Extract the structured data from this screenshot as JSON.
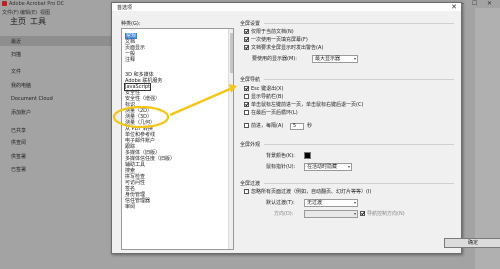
{
  "app": {
    "title": "Adobe Acrobat Pro DC",
    "menu": [
      "文件(F)",
      "编辑(E)",
      "视图"
    ],
    "tabs": [
      "主页",
      "工具"
    ],
    "left_items": [
      "最近",
      "扫描",
      "文件",
      "我的电脑",
      "Document Cloud",
      "添加账户",
      "已共享",
      "供查阅",
      "供签署",
      "已签署"
    ],
    "sections": [
      "位置",
      "共享"
    ]
  },
  "dialog": {
    "title": "首选项",
    "close": "✕",
    "category_label": "种类(G):",
    "categories": [
      "常规",
      "文档",
      "页面显示",
      "一般",
      "注释",
      "3D 和多媒体",
      "Adobe 联机服务",
      "JavaScript",
      "安全性",
      "安全性（增强）",
      "标识",
      "测量（2D）",
      "测量（3D）",
      "测量（几何）",
      "从 PDF 转换",
      "单位和参考线",
      "电子邮件账户",
      "跟踪",
      "多媒体（旧版）",
      "多媒体信任度（旧版）",
      "辅助工具",
      "搜索",
      "拼写检查",
      "可访问性",
      "签名",
      "身份管理",
      "信任管理器",
      "审阅"
    ],
    "selected_category": "常规",
    "highlighted_category": "JavaScript",
    "groups": {
      "general": {
        "title": "全屏设置",
        "opt1": "仅限于当前文档(N)",
        "opt2": "一次使用一页填充屏幕(F)",
        "opt3": "文档要求全屏显示时发出警告(A)",
        "monitor_label": "要使用的显示器(M):",
        "monitor_value": "最大显示器"
      },
      "nav": {
        "title": "全屏导航",
        "opt1": "Esc 键退出(X)",
        "opt2": "显示导航栏(B)",
        "opt3": "单击鼠标左键前进一页，单击鼠标右键后退一页(C)",
        "opt4": "在最后一页后循环(L)",
        "opt5": "前进，每隔(A)",
        "seconds_value": "5",
        "seconds_unit": "秒"
      },
      "appearance": {
        "title": "全屏外观",
        "bg_label": "背景颜色(K):",
        "cursor_label": "鼠标指针(U):",
        "cursor_value": "在活动时隐藏"
      },
      "transition": {
        "title": "全屏过渡",
        "ignore": "忽略所有页面过渡（例如，自动翻页、幻灯片等等）(I)",
        "default_label": "默认过渡(T):",
        "default_value": "无过渡",
        "dir_label": "方向(D):",
        "dir_value": "",
        "nav_dir": "导航控制方向(N)"
      }
    },
    "ok": "确定",
    "cancel": "取消"
  },
  "colors": {
    "selection": "#3b7fd6",
    "callout": "#f5c518"
  }
}
